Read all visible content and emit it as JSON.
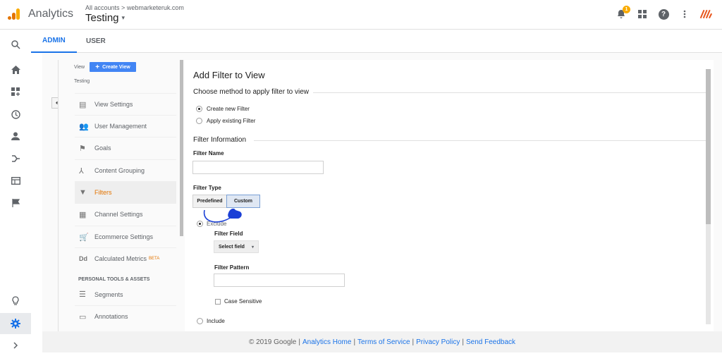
{
  "topbar": {
    "app_name": "Analytics",
    "breadcrumb_root": "All accounts",
    "breadcrumb_sep": ">",
    "breadcrumb_account": "webmarketeruk.com",
    "view_name": "Testing",
    "view_caret": "▾",
    "notification_count": "1",
    "icons": [
      "bell-icon",
      "apps-grid-icon",
      "help-icon",
      "more-vert-icon",
      "account-logo-icon"
    ]
  },
  "tabs": [
    {
      "label": "ADMIN",
      "active": true
    },
    {
      "label": "USER",
      "active": false
    }
  ],
  "leftnav": [
    "search-icon",
    "home-icon",
    "customization-icon",
    "realtime-clock-icon",
    "audience-person-icon",
    "acquisition-icon",
    "behavior-icon",
    "conversions-flag-icon",
    "lightbulb-icon",
    "settings-gear-icon",
    "expand-chevron-icon"
  ],
  "view_column": {
    "label": "View",
    "create_button": "Create View",
    "create_plus": "+",
    "view_name": "Testing",
    "back_glyph": "↤",
    "items": [
      {
        "label": "View Settings",
        "icon": "document-icon",
        "glyph": "▤"
      },
      {
        "label": "User Management",
        "icon": "people-icon",
        "glyph": "👥"
      },
      {
        "label": "Goals",
        "icon": "flag-icon",
        "glyph": "⚑"
      },
      {
        "label": "Content Grouping",
        "icon": "grouping-icon",
        "glyph": "⅄"
      },
      {
        "label": "Filters",
        "icon": "filter-icon",
        "glyph": "▼",
        "active": true
      },
      {
        "label": "Channel Settings",
        "icon": "channel-icon",
        "glyph": "▦"
      },
      {
        "label": "Ecommerce Settings",
        "icon": "cart-icon",
        "glyph": "🛒"
      },
      {
        "label": "Calculated Metrics",
        "icon": "dd-icon",
        "glyph": "Dd",
        "badge": "BETA"
      }
    ],
    "section_header": "PERSONAL TOOLS & ASSETS",
    "personal_items": [
      {
        "label": "Segments",
        "icon": "segments-icon",
        "glyph": "☰"
      },
      {
        "label": "Annotations",
        "icon": "annotations-icon",
        "glyph": "▭"
      }
    ]
  },
  "form": {
    "title": "Add Filter to View",
    "method_heading": "Choose method to apply filter to view",
    "method_options": [
      {
        "label": "Create new Filter",
        "selected": true
      },
      {
        "label": "Apply existing Filter",
        "selected": false
      }
    ],
    "info_heading": "Filter Information",
    "filter_name_label": "Filter Name",
    "filter_name_value": "",
    "filter_type_label": "Filter Type",
    "type_buttons": [
      {
        "label": "Predefined",
        "selected": false
      },
      {
        "label": "Custom",
        "selected": true
      }
    ],
    "exclude_label": "Exclude",
    "exclude_selected": true,
    "filter_field_label": "Filter Field",
    "filter_field_select": "Select field",
    "select_arrow": "▾",
    "filter_pattern_label": "Filter Pattern",
    "filter_pattern_value": "",
    "case_sensitive_label": "Case Sensitive",
    "case_sensitive_checked": false,
    "include_label": "Include"
  },
  "footer": {
    "copyright": "© 2019 Google",
    "links": [
      "Analytics Home",
      "Terms of Service",
      "Privacy Policy",
      "Send Feedback"
    ],
    "separator": "|"
  },
  "colors": {
    "accent_blue": "#1a73e8",
    "create_button_blue": "#4285f4",
    "active_orange": "#e37400",
    "badge_yellow": "#f9ab00",
    "annotation_blue": "#1a3fd6"
  }
}
